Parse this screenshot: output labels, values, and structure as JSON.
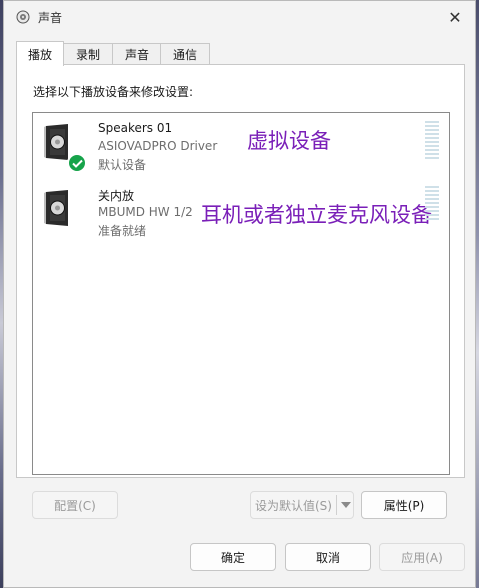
{
  "window": {
    "title": "声音",
    "close_glyph": "✕"
  },
  "tabs": [
    {
      "label": "播放",
      "active": true
    },
    {
      "label": "录制",
      "active": false
    },
    {
      "label": "声音",
      "active": false
    },
    {
      "label": "通信",
      "active": false
    }
  ],
  "playback": {
    "instruction": "选择以下播放设备来修改设置:",
    "devices": [
      {
        "name": "Speakers 01",
        "driver": "ASIOVADPRO Driver",
        "status": "默认设备",
        "default": true,
        "annotation": "虚拟设备"
      },
      {
        "name": "关内放",
        "driver": "MBUMD HW 1/2",
        "status": "准备就绪",
        "default": false,
        "annotation": "耳机或者独立麦克风设备"
      }
    ],
    "buttons": {
      "configure": "配置(C)",
      "set_default": "设为默认值(S)",
      "properties": "属性(P)"
    }
  },
  "footer": {
    "ok": "确定",
    "cancel": "取消",
    "apply": "应用(A)"
  },
  "colors": {
    "annotation": "#7a1fb8",
    "check": "#16a34a",
    "meter": "#cfe0e8"
  },
  "icons": [
    "speaker-sound-icon",
    "speaker-device-icon",
    "default-check-icon",
    "chevron-down-icon",
    "close-icon"
  ]
}
